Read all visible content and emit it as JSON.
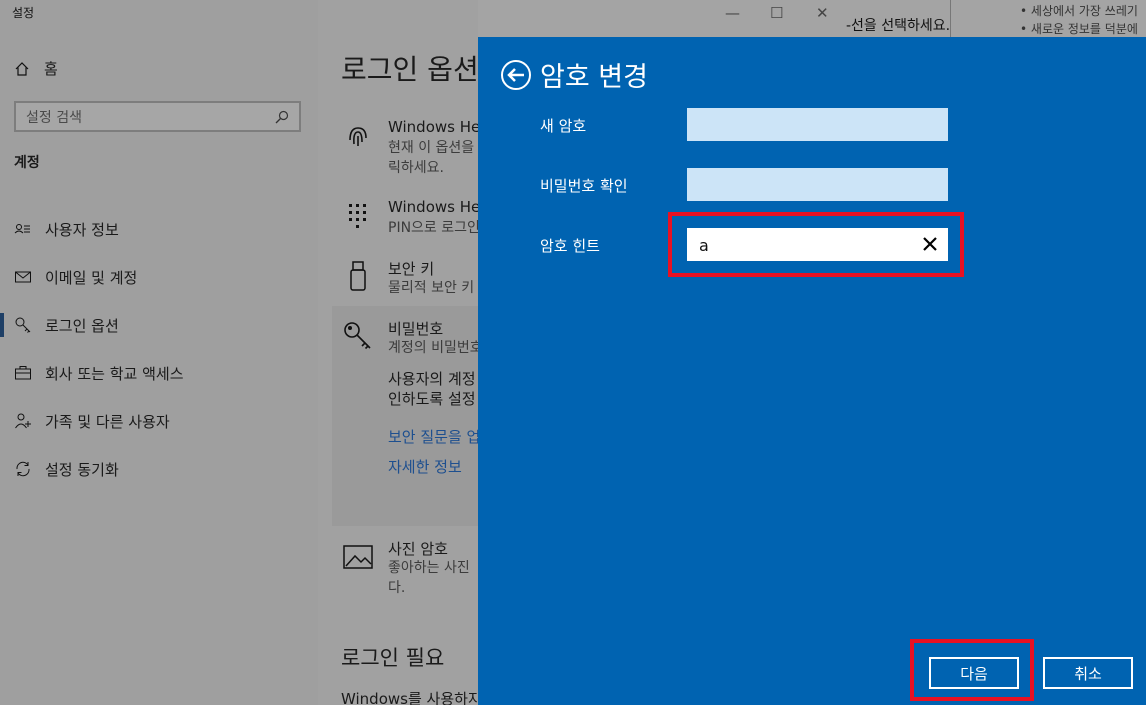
{
  "window": {
    "title": "설정"
  },
  "sidebar": {
    "home_label": "홈",
    "search_placeholder": "설정 검색",
    "section": "계정",
    "items": [
      {
        "label": "사용자 정보",
        "icon": "user-info-icon"
      },
      {
        "label": "이메일 및 계정",
        "icon": "mail-icon"
      },
      {
        "label": "로그인 옵션",
        "icon": "key-icon",
        "active": true
      },
      {
        "label": "회사 또는 학교 액세스",
        "icon": "briefcase-icon"
      },
      {
        "label": "가족 및 다른 사용자",
        "icon": "person-add-icon"
      },
      {
        "label": "설정 동기화",
        "icon": "sync-icon"
      }
    ]
  },
  "content": {
    "page_title": "로그인 옵션",
    "options": [
      {
        "title": "Windows Hello",
        "desc1": "현재 이 옵션을",
        "desc2": "릭하세요."
      },
      {
        "title": "Windows Hello",
        "desc1": "PIN으로 로그인"
      },
      {
        "title": "보안 키",
        "desc1": "물리적 보안 키"
      },
      {
        "title": "비밀번호",
        "desc1": "계정의 비밀번호",
        "body1": "사용자의 계정",
        "body2": "인하도록 설정"
      }
    ],
    "links": [
      "보안 질문을 업데이트",
      "자세한 정보"
    ],
    "picture": {
      "title": "사진 암호",
      "desc1": "좋아하는 사진",
      "desc2": "다."
    },
    "sub_header": "로그인 필요",
    "bottom_text": "Windows를 사용하지"
  },
  "background": {
    "snippet": "-선을 선택하세요.",
    "bullets": [
      "세상에서 가장 쓰레기",
      "새로운 정보를 덕분에"
    ]
  },
  "dialog": {
    "title": "암호 변경",
    "fields": [
      {
        "label": "새 암호",
        "value": ""
      },
      {
        "label": "비밀번호 확인",
        "value": ""
      },
      {
        "label": "암호 힌트",
        "value": "a"
      }
    ],
    "next_label": "다음",
    "cancel_label": "취소",
    "colors": {
      "dialog_bg": "#0063b1",
      "highlight": "#e81123",
      "field_bg": "#cce4f7"
    }
  }
}
